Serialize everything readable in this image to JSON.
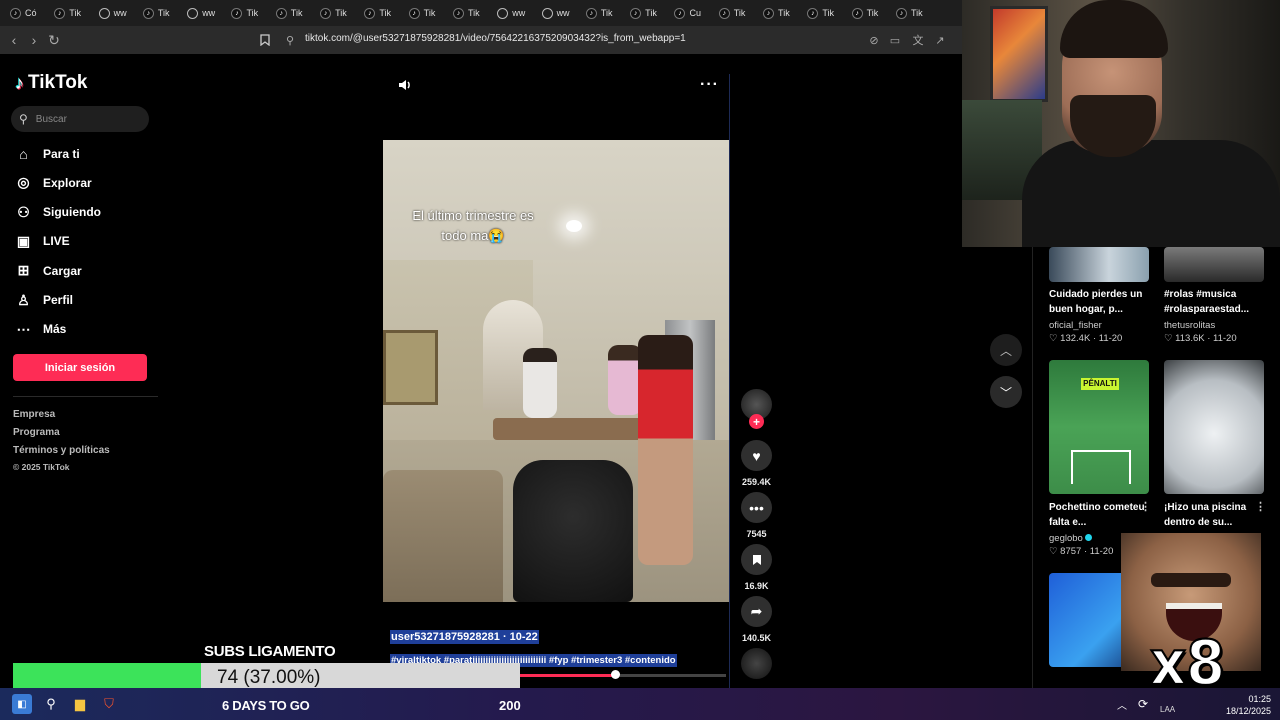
{
  "browser": {
    "tabs": [
      {
        "label": "Có",
        "icon": "tiktok-icon"
      },
      {
        "label": "Tik",
        "icon": "tiktok-icon"
      },
      {
        "label": "ww",
        "icon": "globe-icon"
      },
      {
        "label": "Tik",
        "icon": "tiktok-icon"
      },
      {
        "label": "ww",
        "icon": "globe-icon"
      },
      {
        "label": "Tik",
        "icon": "tiktok-icon"
      },
      {
        "label": "Tik",
        "icon": "tiktok-icon"
      },
      {
        "label": "Tik",
        "icon": "tiktok-icon"
      },
      {
        "label": "Tik",
        "icon": "tiktok-icon"
      },
      {
        "label": "Tik",
        "icon": "tiktok-icon"
      },
      {
        "label": "Tik",
        "icon": "tiktok-icon"
      },
      {
        "label": "ww",
        "icon": "globe-icon"
      },
      {
        "label": "ww",
        "icon": "globe-icon"
      },
      {
        "label": "Tik",
        "icon": "tiktok-icon"
      },
      {
        "label": "Tik",
        "icon": "tiktok-icon"
      },
      {
        "label": "Cu",
        "icon": "tiktok-icon"
      },
      {
        "label": "Tik",
        "icon": "tiktok-icon"
      },
      {
        "label": "Tik",
        "icon": "tiktok-icon"
      },
      {
        "label": "Tik",
        "icon": "tiktok-icon"
      },
      {
        "label": "Tik",
        "icon": "tiktok-icon"
      },
      {
        "label": "Tik",
        "icon": "tiktok-icon"
      }
    ],
    "url": "tiktok.com/@user53271875928281/video/7564221637520903432?is_from_webapp=1"
  },
  "sidebar": {
    "logo": "TikTok",
    "search_placeholder": "Buscar",
    "items": [
      {
        "label": "Para ti",
        "icon": "home-icon"
      },
      {
        "label": "Explorar",
        "icon": "compass-icon"
      },
      {
        "label": "Siguiendo",
        "icon": "following-icon"
      },
      {
        "label": "LIVE",
        "icon": "live-icon"
      },
      {
        "label": "Cargar",
        "icon": "upload-icon"
      },
      {
        "label": "Perfil",
        "icon": "profile-icon"
      },
      {
        "label": "Más",
        "icon": "more-icon"
      }
    ],
    "login_label": "Iniciar sesión",
    "footer": [
      "Empresa",
      "Programa",
      "Términos y políticas",
      "© 2025 TikTok"
    ]
  },
  "video": {
    "overlay_text_line1": "El último trimestre es",
    "overlay_text_line2": "todo ma😭",
    "author_line": "user53271875928281 · 10-22",
    "hashtags": "#viraltiktok #paratiiiiiiiiiiiiiiiiiiiiiiiiiiii #fyp #trimester3 #contenido",
    "progress": 0.46
  },
  "actions": {
    "likes": "259.4K",
    "comments": "7545",
    "saves": "16.9K",
    "shares": "140.5K"
  },
  "recommended": [
    {
      "title": "Cuidado pierdes un buen hogar, p...",
      "user": "oficial_fisher",
      "likes": "132.4K",
      "date": "11-20"
    },
    {
      "title": "#rolas #musica #rolasparaestad...",
      "user": "thetusrolitas",
      "likes": "113.6K",
      "date": "11-20"
    },
    {
      "title": "Pochettino cometeu falta e...",
      "user": "geglobo",
      "likes": "8757",
      "date": "11-20",
      "thumb_text": "PÊNALTI"
    },
    {
      "title": "¡Hizo una piscina dentro de su...",
      "user": "",
      "likes": "",
      "date": ""
    }
  ],
  "stream_overlay": {
    "subs_title": "SUBS LIGAMENTO",
    "subs_value": "74 (37.00%)",
    "subs_fraction": 0.37,
    "days_to_go": "6 DAYS TO GO",
    "goal": "200",
    "meme_text": "x8"
  },
  "taskbar": {
    "lang": "LAA",
    "time": "01:25",
    "date": "18/12/2025"
  },
  "colors": {
    "accent": "#fe2c55",
    "progress_green": "#3ce35a",
    "selection_blue": "#1f3f99"
  }
}
